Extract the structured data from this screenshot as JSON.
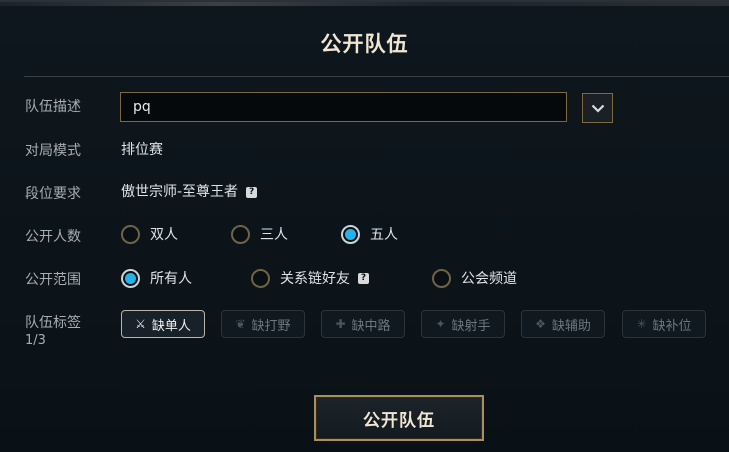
{
  "dialog": {
    "title": "公开队伍",
    "submit_label": "公开队伍"
  },
  "description": {
    "label": "队伍描述",
    "value": "pq",
    "dropdown_icon": "chevron-down-icon"
  },
  "mode": {
    "label": "对局模式",
    "value": "排位赛"
  },
  "rank": {
    "label": "段位要求",
    "value": "傲世宗师-至尊王者",
    "help_icon": "?"
  },
  "player_count": {
    "label": "公开人数",
    "options": [
      {
        "label": "双人",
        "selected": false
      },
      {
        "label": "三人",
        "selected": false
      },
      {
        "label": "五人",
        "selected": true
      }
    ]
  },
  "scope": {
    "label": "公开范围",
    "options": [
      {
        "label": "所有人",
        "selected": true
      },
      {
        "label": "关系链好友",
        "selected": false,
        "help_icon": "?"
      },
      {
        "label": "公会频道",
        "selected": false
      }
    ]
  },
  "tags": {
    "label": "队伍标签",
    "count": "1/3",
    "items": [
      {
        "label": "缺单人",
        "icon": "solo-lane-icon",
        "active": true
      },
      {
        "label": "缺打野",
        "icon": "jungle-icon",
        "active": false
      },
      {
        "label": "缺中路",
        "icon": "mid-lane-icon",
        "active": false
      },
      {
        "label": "缺射手",
        "icon": "marksman-icon",
        "active": false
      },
      {
        "label": "缺辅助",
        "icon": "support-icon",
        "active": false
      },
      {
        "label": "缺补位",
        "icon": "fill-icon",
        "active": false
      }
    ]
  },
  "colors": {
    "accent_gold": "#a9905a",
    "radio_selected": "#21b4ea",
    "background": "#0b1218"
  }
}
